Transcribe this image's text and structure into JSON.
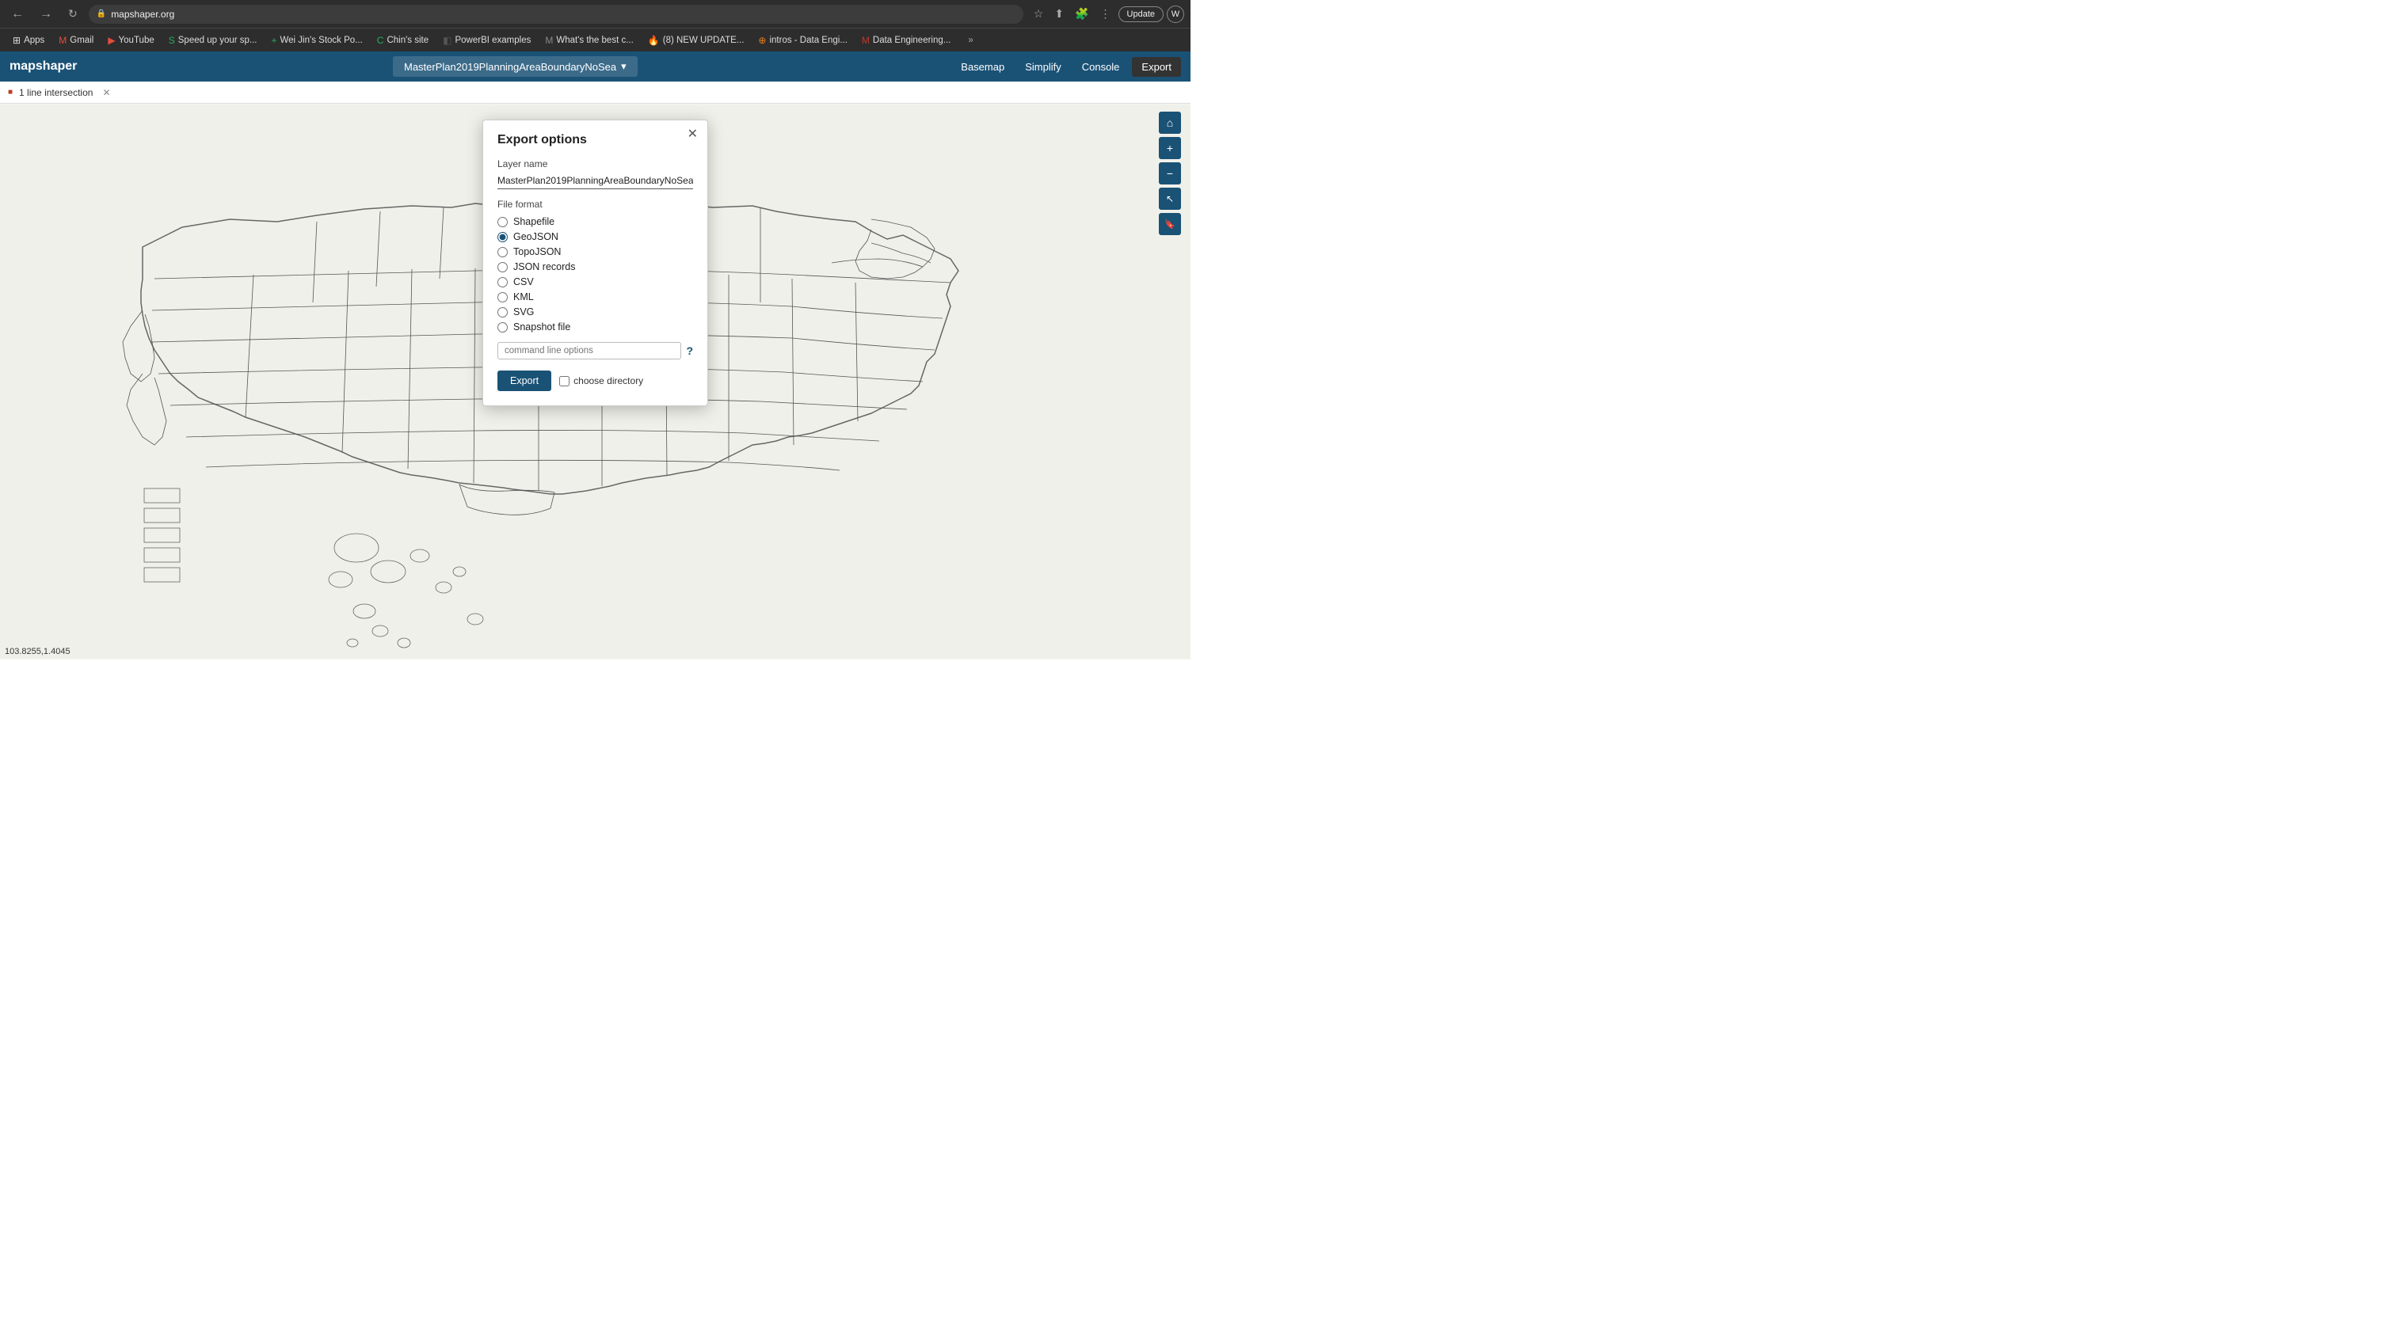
{
  "browser": {
    "url": "mapshaper.org",
    "back_label": "←",
    "forward_label": "→",
    "reload_label": "↺",
    "update_label": "Update",
    "profile_label": "W",
    "more_label": "⋮",
    "extension_more": "»"
  },
  "bookmarks": [
    {
      "id": "apps",
      "label": "Apps",
      "icon": "⊞"
    },
    {
      "id": "gmail",
      "label": "Gmail",
      "icon": "M"
    },
    {
      "id": "youtube",
      "label": "YouTube",
      "icon": "▶"
    },
    {
      "id": "speedup",
      "label": "Speed up your sp...",
      "icon": "S"
    },
    {
      "id": "weijin",
      "label": "Wei Jin's Stock Po...",
      "icon": "+"
    },
    {
      "id": "chins",
      "label": "Chin's site",
      "icon": "C"
    },
    {
      "id": "powerbi",
      "label": "PowerBI examples",
      "icon": "◧"
    },
    {
      "id": "whats",
      "label": "What's the best c...",
      "icon": "M"
    },
    {
      "id": "newupdate",
      "label": "(8) NEW UPDATE...",
      "icon": "🔥"
    },
    {
      "id": "intros",
      "label": "intros - Data Engi...",
      "icon": "⊕"
    },
    {
      "id": "dataeng",
      "label": "Data Engineering...",
      "icon": "M"
    },
    {
      "id": "more",
      "label": "»",
      "icon": ""
    }
  ],
  "appbar": {
    "logo": "mapshaper",
    "layer_name": "MasterPlan2019PlanningAreaBoundaryNoSea",
    "dropdown_arrow": "▾",
    "nav": {
      "basemap": "Basemap",
      "simplify": "Simplify",
      "console": "Console",
      "export": "Export"
    }
  },
  "notification": {
    "text": "1 line intersection",
    "close": "✕"
  },
  "modal": {
    "title": "Export options",
    "close": "✕",
    "layer_name_label": "Layer name",
    "layer_name_value": "MasterPlan2019PlanningAreaBoundaryNoSea",
    "file_format_label": "File format",
    "formats": [
      {
        "id": "shapefile",
        "label": "Shapefile",
        "checked": false
      },
      {
        "id": "geojson",
        "label": "GeoJSON",
        "checked": true
      },
      {
        "id": "topojson",
        "label": "TopoJSON",
        "checked": false
      },
      {
        "id": "json-records",
        "label": "JSON records",
        "checked": false
      },
      {
        "id": "csv",
        "label": "CSV",
        "checked": false
      },
      {
        "id": "kml",
        "label": "KML",
        "checked": false
      },
      {
        "id": "svg",
        "label": "SVG",
        "checked": false
      },
      {
        "id": "snapshot",
        "label": "Snapshot file",
        "checked": false
      }
    ],
    "cmd_placeholder": "command line options",
    "help_label": "?",
    "export_btn": "Export",
    "choose_dir_label": "choose directory"
  },
  "map": {
    "controls": {
      "home": "⌂",
      "zoom_in": "+",
      "zoom_out": "−",
      "cursor": "↖",
      "bookmark": "🔖"
    }
  },
  "coords": {
    "value": "103.8255,1.4045"
  }
}
